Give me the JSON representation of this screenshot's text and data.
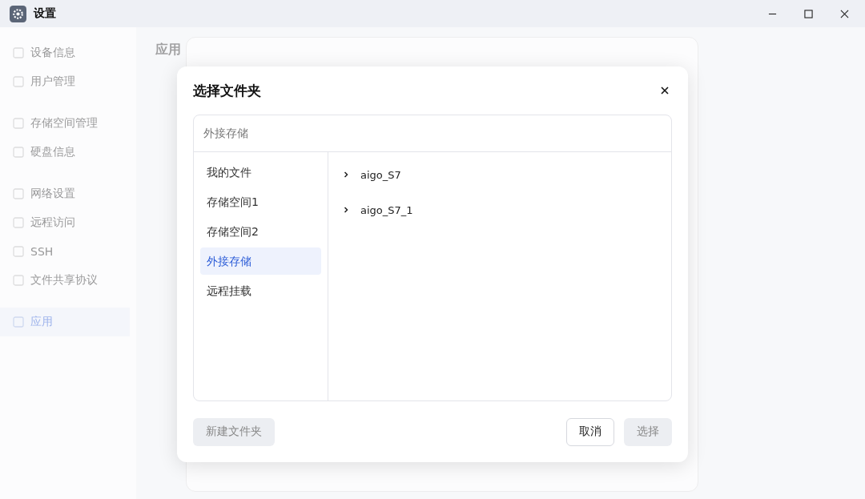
{
  "window": {
    "title": "设置"
  },
  "sidebar": {
    "groups": [
      [
        {
          "label": "设备信息",
          "selected": false
        },
        {
          "label": "用户管理",
          "selected": false
        }
      ],
      [
        {
          "label": "存储空间管理",
          "selected": false
        },
        {
          "label": "硬盘信息",
          "selected": false
        }
      ],
      [
        {
          "label": "网络设置",
          "selected": false
        },
        {
          "label": "远程访问",
          "selected": false
        },
        {
          "label": "SSH",
          "selected": false
        },
        {
          "label": "文件共享协议",
          "selected": false
        }
      ],
      [
        {
          "label": "应用",
          "selected": true
        }
      ]
    ]
  },
  "page": {
    "title": "应用"
  },
  "dialog": {
    "title": "选择文件夹",
    "path": "外接存储",
    "locations": [
      {
        "label": "我的文件",
        "selected": false
      },
      {
        "label": "存储空间1",
        "selected": false
      },
      {
        "label": "存储空间2",
        "selected": false
      },
      {
        "label": "外接存储",
        "selected": true
      },
      {
        "label": "远程挂载",
        "selected": false
      }
    ],
    "folders": [
      {
        "name": "aigo_S7",
        "expanded": false
      },
      {
        "name": "aigo_S7_1",
        "expanded": false
      }
    ],
    "buttons": {
      "new_folder": {
        "label": "新建文件夹",
        "disabled": true
      },
      "cancel": {
        "label": "取消",
        "disabled": false
      },
      "select": {
        "label": "选择",
        "disabled": true
      }
    }
  }
}
